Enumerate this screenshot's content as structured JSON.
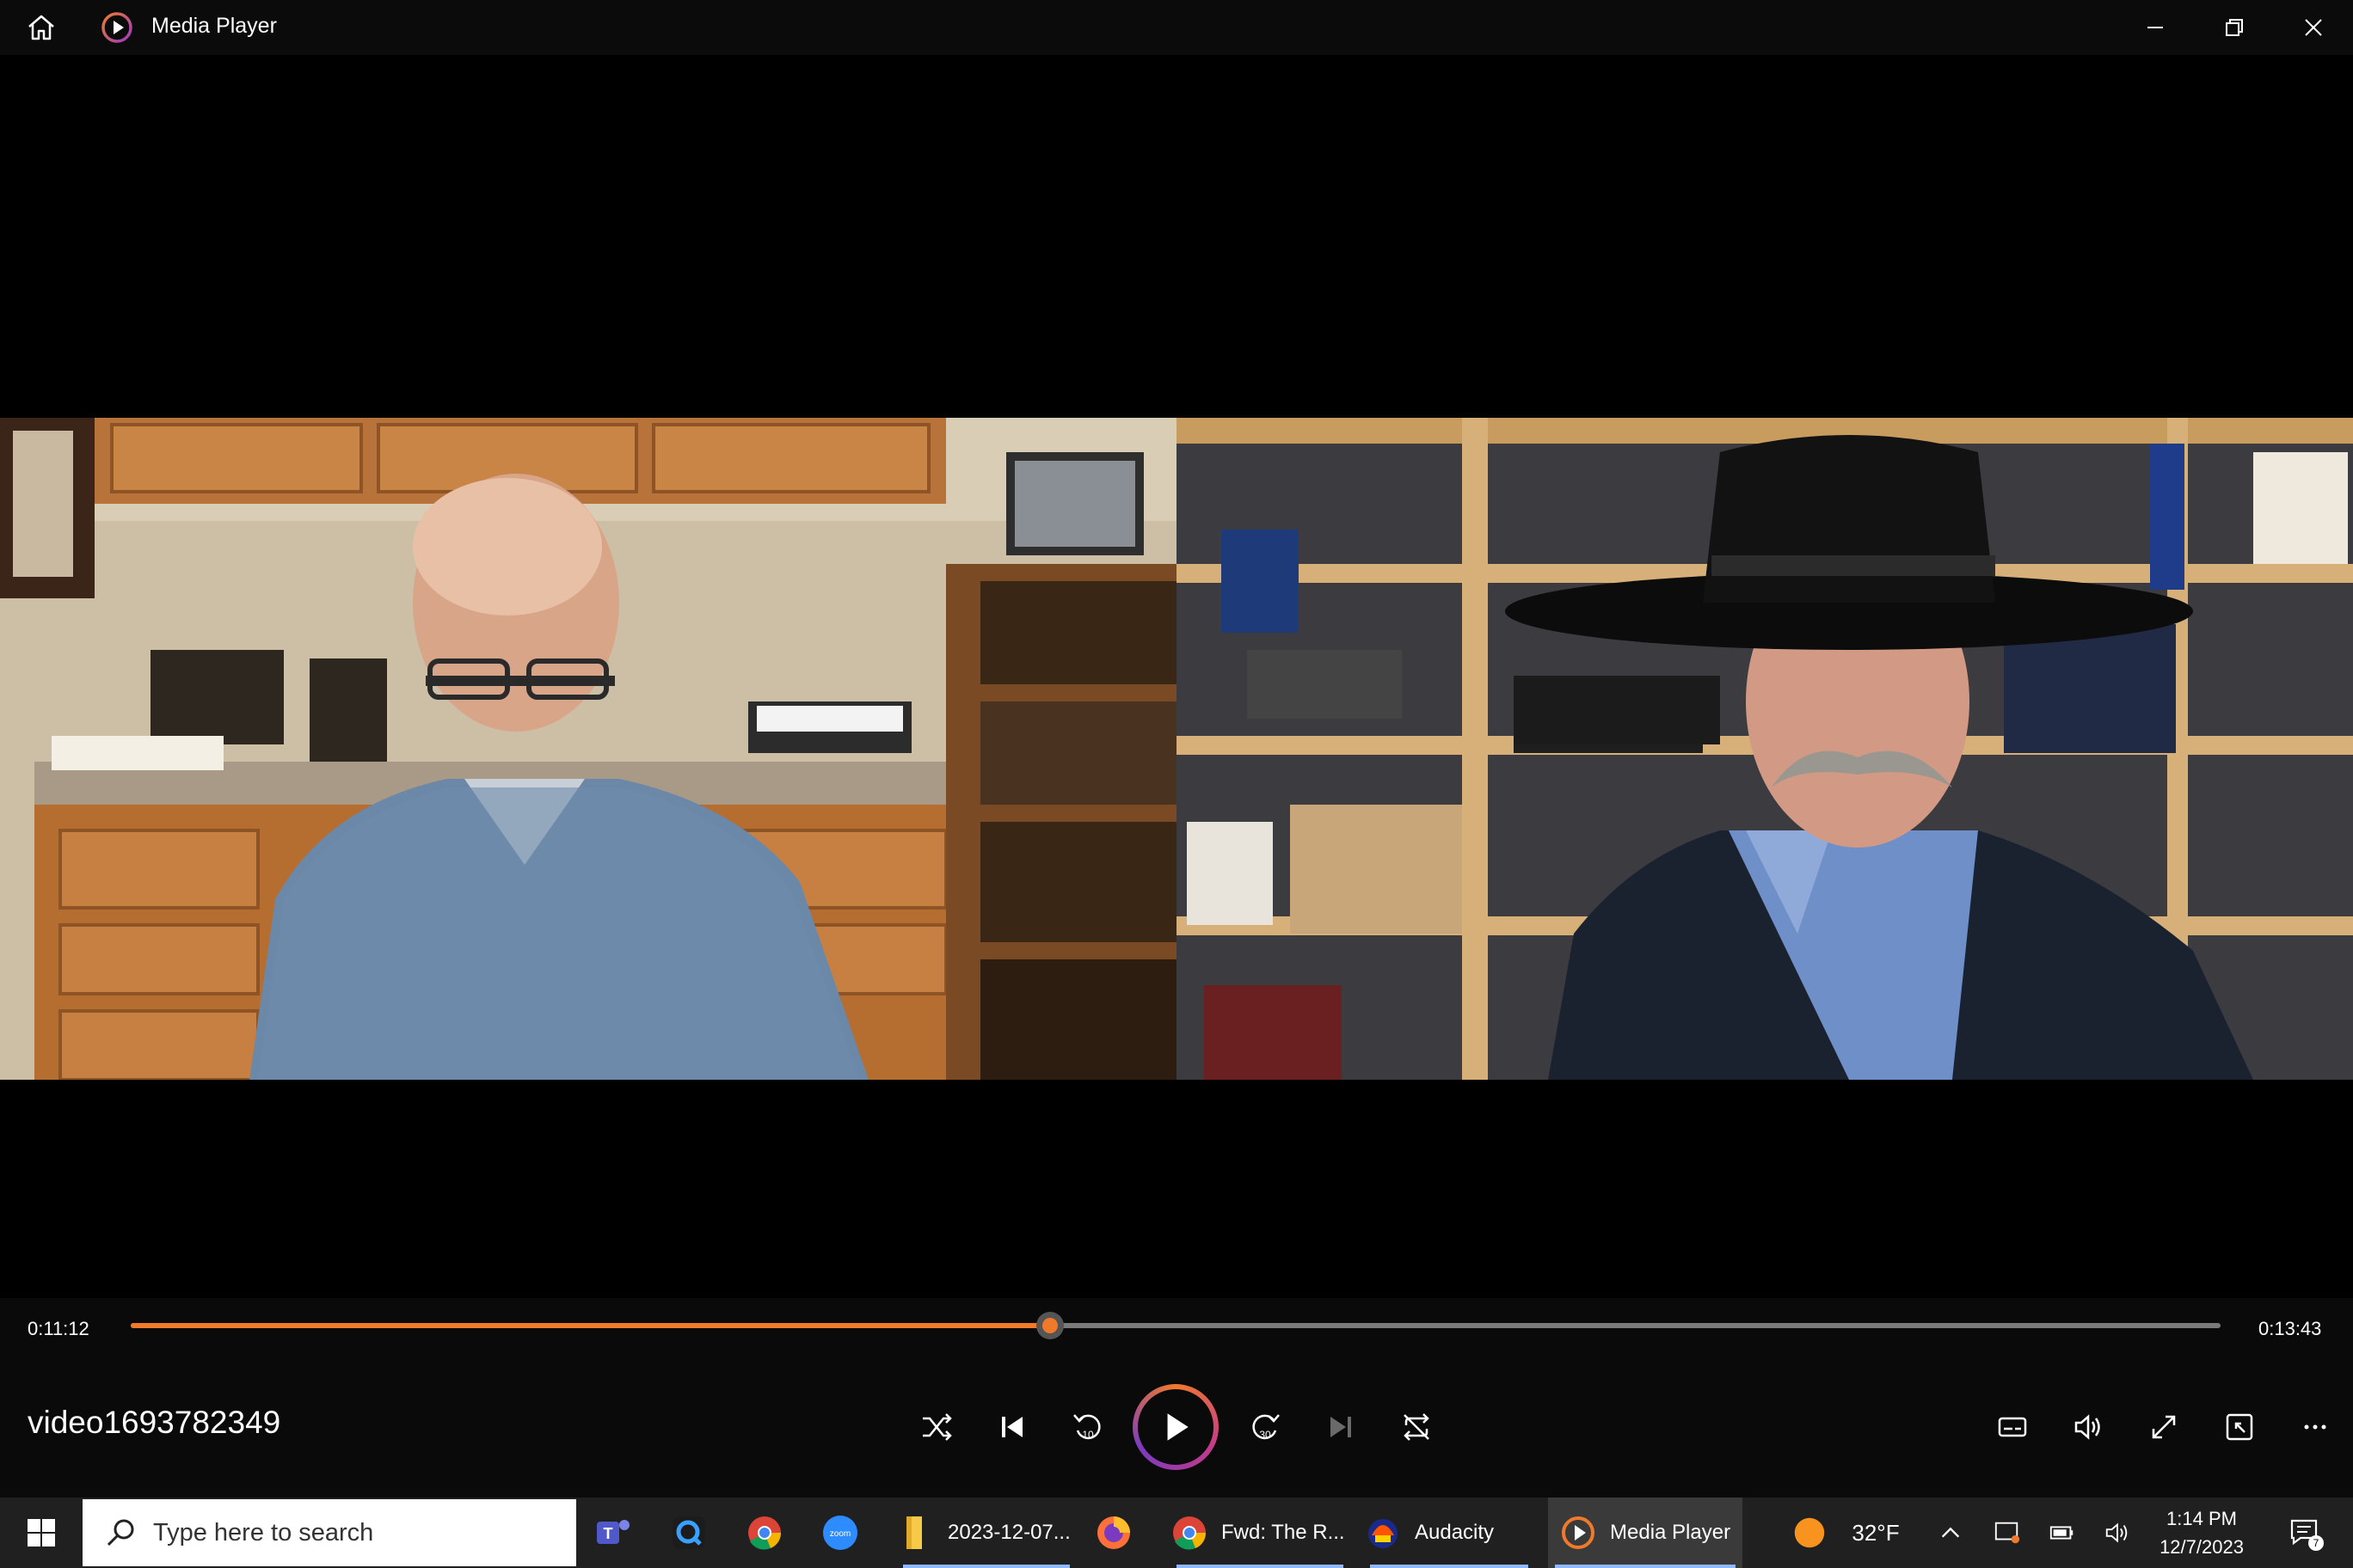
{
  "titlebar": {
    "app_title": "Media Player",
    "icons": [
      "home-icon",
      "media-player-app-icon",
      "minimize-icon",
      "restore-icon",
      "close-icon"
    ]
  },
  "player": {
    "elapsed": "0:11:12",
    "duration": "0:13:43",
    "progress_fraction": 0.44,
    "media_title": "video1693782349",
    "accent_color": "#f07a2c",
    "controls": [
      "shuffle-icon",
      "previous-icon",
      "rewind-10-icon",
      "play-icon",
      "forward-30-icon",
      "next-icon",
      "repeat-icon"
    ],
    "rewind_label": "10",
    "forward_label": "30",
    "right_controls": [
      "captions-icon",
      "volume-icon",
      "fullscreen-icon",
      "miniplayer-icon",
      "more-icon"
    ]
  },
  "taskbar": {
    "search_placeholder": "Type here to search",
    "items": [
      {
        "icon": "teams-icon",
        "label": ""
      },
      {
        "icon": "quick-assist-icon",
        "label": ""
      },
      {
        "icon": "chrome-icon",
        "label": ""
      },
      {
        "icon": "zoom-icon",
        "label": "zoom"
      },
      {
        "icon": "folder-icon",
        "label": "2023-12-07..."
      },
      {
        "icon": "firefox-icon",
        "label": ""
      },
      {
        "icon": "chrome-profile-icon",
        "label": "Fwd: The R..."
      },
      {
        "icon": "audacity-icon",
        "label": "Audacity"
      },
      {
        "icon": "media-player-icon",
        "label": "Media Player"
      }
    ],
    "weather": "32°F",
    "time": "1:14 PM",
    "date": "12/7/2023",
    "notification_count": "7"
  }
}
